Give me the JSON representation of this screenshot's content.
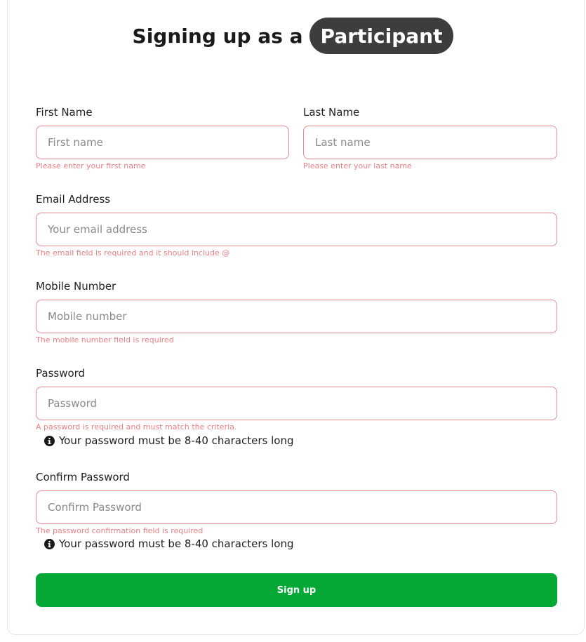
{
  "heading": {
    "lead": "Signing up as a",
    "role": "Participant"
  },
  "fields": {
    "first_name": {
      "label": "First Name",
      "placeholder": "First name",
      "value": "",
      "error": "Please enter your first name"
    },
    "last_name": {
      "label": "Last Name",
      "placeholder": "Last name",
      "value": "",
      "error": "Please enter your last name"
    },
    "email": {
      "label": "Email Address",
      "placeholder": "Your email address",
      "value": "",
      "error": "The email field is required and it should include @"
    },
    "mobile": {
      "label": "Mobile Number",
      "placeholder": "Mobile number",
      "value": "",
      "error": "The mobile number field is required"
    },
    "password": {
      "label": "Password",
      "placeholder": "Password",
      "value": "",
      "error": "A password is required and must match the criteria.",
      "hint": "Your password must be 8-40 characters long"
    },
    "confirm_password": {
      "label": "Confirm Password",
      "placeholder": "Confirm Password",
      "value": "",
      "error": "The password confirmation field is required",
      "hint": "Your password must be 8-40 characters long"
    }
  },
  "submit": {
    "label": "Sign up"
  },
  "colors": {
    "accent": "#05a834",
    "error": "#ea7f85",
    "pill": "#3d3d3d"
  },
  "icons": {
    "hint_icon": "info-circle-icon"
  }
}
